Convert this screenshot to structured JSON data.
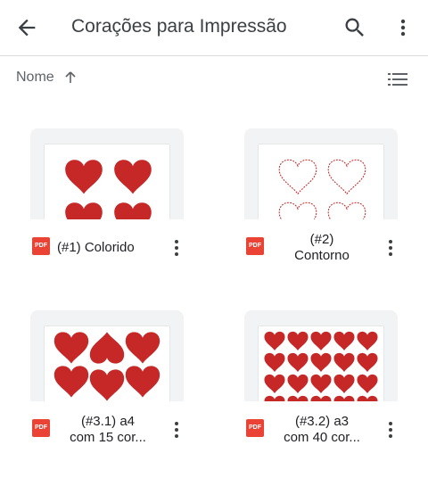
{
  "appbar": {
    "title": "Corações para Impressão",
    "icons": {
      "back": "arrow-back-icon",
      "search": "search-icon",
      "more": "more-vert-icon"
    }
  },
  "sort": {
    "label": "Nome",
    "direction": "ascending",
    "view_icon": "list-view-icon"
  },
  "colors": {
    "heart": "#c62828",
    "pdf": "#ea4335",
    "thumb_bg": "#f1f3f4"
  },
  "files": [
    {
      "type": "PDF",
      "name_lines": [
        "(#1) Colorido"
      ],
      "thumbnail": "four-filled-hearts"
    },
    {
      "type": "PDF",
      "name_lines": [
        "(#2)",
        "Contorno"
      ],
      "thumbnail": "four-outlined-hearts"
    },
    {
      "type": "PDF",
      "name_lines": [
        "(#3.1) a4",
        "com 15 cor..."
      ],
      "thumbnail": "fifteen-filled-hearts"
    },
    {
      "type": "PDF",
      "name_lines": [
        "(#3.2) a3",
        "com 40 cor..."
      ],
      "thumbnail": "forty-filled-hearts"
    }
  ]
}
